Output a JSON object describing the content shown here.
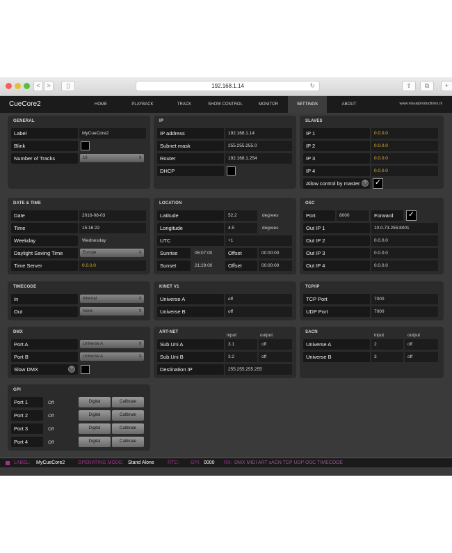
{
  "browser": {
    "back": "<",
    "forward": ">",
    "sidebar": "▯",
    "url": "192.168.1.14",
    "reload": "↻",
    "share": "⇪",
    "tabs": "⧉",
    "new_tab": "+"
  },
  "app": {
    "title": "CueCore2",
    "site": "www.visualproductions.nl"
  },
  "tabs": [
    "HOME",
    "PLAYBACK",
    "TRACK",
    "SHOW CONTROL",
    "MONITOR",
    "SETTINGS",
    "ABOUT"
  ],
  "general": {
    "title": "GENERAL",
    "label_lbl": "Label",
    "label_val": "MyCueCore2",
    "blink_lbl": "Blink",
    "tracks_lbl": "Number of Tracks",
    "tracks_val": "16"
  },
  "ip": {
    "title": "IP",
    "address_lbl": "IP address",
    "address_val": "192.168.1.14",
    "subnet_lbl": "Subnet mask",
    "subnet_val": "255.255.255.0",
    "router_lbl": "Router",
    "router_val": "192.168.1.254",
    "dhcp_lbl": "DHCP"
  },
  "slaves": {
    "title": "SLAVES",
    "ip1_lbl": "IP 1",
    "ip1_val": "0.0.0.0",
    "ip2_lbl": "IP 2",
    "ip2_val": "0.0.0.0",
    "ip3_lbl": "IP 3",
    "ip3_val": "0.0.0.0",
    "ip4_lbl": "IP 4",
    "ip4_val": "0.0.0.0",
    "allow_lbl": "Allow control by master",
    "help": "?",
    "allow_check": "✓"
  },
  "datetime": {
    "title": "DATE & TIME",
    "date_lbl": "Date",
    "date_val": "2016-08-03",
    "time_lbl": "Time",
    "time_val": "15:16:22",
    "weekday_lbl": "Weekday",
    "weekday_val": "Wednesday",
    "dst_lbl": "Daylight Saving Time",
    "dst_val": "Europe",
    "server_lbl": "Time Server",
    "server_val": "0.0.0.0"
  },
  "location": {
    "title": "LOCATION",
    "lat_lbl": "Latitude",
    "lat_val": "52.2",
    "lat_unit": "degrees",
    "lon_lbl": "Longitude",
    "lon_val": "4.5",
    "lon_unit": "degrees",
    "utc_lbl": "UTC",
    "utc_val": "+1",
    "sunrise_lbl": "Sunrise",
    "sunrise_val": "06:07:00",
    "offset1_lbl": "Offset",
    "offset1_val": "00:00:00",
    "sunset_lbl": "Sunset",
    "sunset_val": "21:29:00",
    "offset2_lbl": "Offset",
    "offset2_val": "00:00:00"
  },
  "osc": {
    "title": "OSC",
    "port_lbl": "Port",
    "port_val": "8000",
    "forward_lbl": "Forward",
    "forward_check": "✓",
    "out1_lbl": "Out IP 1",
    "out1_val": "10.0.73.255:8001",
    "out2_lbl": "Out IP 2",
    "out2_val": "0.0.0.0",
    "out3_lbl": "Out IP 3",
    "out3_val": "0.0.0.0",
    "out4_lbl": "Out IP 4",
    "out4_val": "0.0.0.0"
  },
  "timecode": {
    "title": "TIMECODE",
    "in_lbl": "In",
    "in_val": "Internal",
    "out_lbl": "Out",
    "out_val": "None"
  },
  "kinet": {
    "title": "KINET V1",
    "a_lbl": "Universe A",
    "a_val": "off",
    "b_lbl": "Universe B",
    "b_val": "off"
  },
  "tcpip": {
    "title": "TCP/IP",
    "tcp_lbl": "TCP Port",
    "tcp_val": "7000",
    "udp_lbl": "UDP Port",
    "udp_val": "7000"
  },
  "dmx": {
    "title": "DMX",
    "a_lbl": "Port A",
    "a_val": "Universe A",
    "b_lbl": "Port B",
    "b_val": "Universe A",
    "slow_lbl": "Slow DMX",
    "help": "?"
  },
  "artnet": {
    "title": "ART-NET",
    "input_hdr": "input",
    "output_hdr": "output",
    "a_lbl": "Sub.Uni A",
    "a_in": "3.1",
    "a_out": "off",
    "b_lbl": "Sub.Uni B",
    "b_in": "3.2",
    "b_out": "off",
    "dest_lbl": "Destination IP",
    "dest_val": "255.255.255.255"
  },
  "sacn": {
    "title": "SACN",
    "input_hdr": "input",
    "output_hdr": "output",
    "a_lbl": "Universe A",
    "a_in": "2",
    "a_out": "off",
    "b_lbl": "Universe B",
    "b_in": "3",
    "b_out": "off"
  },
  "gpi": {
    "title": "GPI",
    "ports": [
      {
        "label": "Port 1",
        "state": "Off",
        "mode": "Digital",
        "calibrate": "Calibrate"
      },
      {
        "label": "Port 2",
        "state": "Off",
        "mode": "Digital",
        "calibrate": "Calibrate"
      },
      {
        "label": "Port 3",
        "state": "Off",
        "mode": "Digital",
        "calibrate": "Calibrate"
      },
      {
        "label": "Port 4",
        "state": "Off",
        "mode": "Digital",
        "calibrate": "Calibrate"
      }
    ]
  },
  "status": {
    "label_key": "LABEL:",
    "label_val": "MyCueCore2",
    "mode_key": "OPERATING MODE:",
    "mode_val": "Stand Alone",
    "rtc_key": "RTC:",
    "gpi_key": "GPI:",
    "gpi_val": "0000",
    "rx_key": "RX:",
    "rx_val": "DMX MIDI ART sACN TCP UDP OSC TIMECODE"
  },
  "colors": {
    "accent": "#a0328a",
    "highlight": "#e8b830",
    "panel": "#2b2b2b",
    "background": "#3a3a3a"
  }
}
